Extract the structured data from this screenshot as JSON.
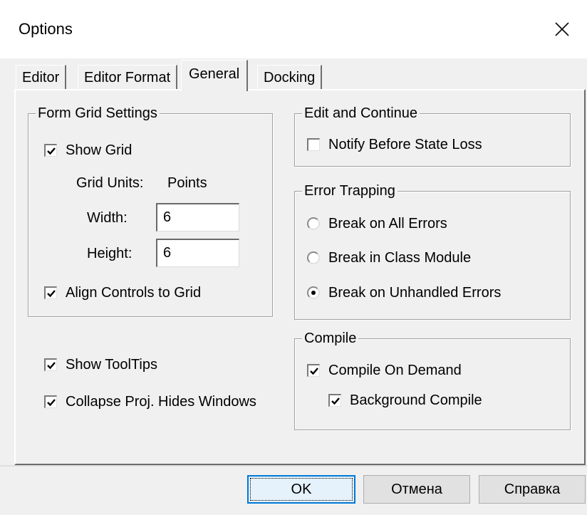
{
  "window": {
    "title": "Options"
  },
  "tabs": [
    {
      "label": "Editor"
    },
    {
      "label": "Editor Format"
    },
    {
      "label": "General",
      "active": true
    },
    {
      "label": "Docking"
    }
  ],
  "form_grid": {
    "title": "Form Grid Settings",
    "show_grid": {
      "label": "Show Grid",
      "checked": true
    },
    "units_label": "Grid Units:",
    "units_value": "Points",
    "width_label": "Width:",
    "width_value": "6",
    "height_label": "Height:",
    "height_value": "6",
    "align": {
      "label": "Align Controls to Grid",
      "checked": true
    }
  },
  "misc": {
    "show_tooltips": {
      "label": "Show ToolTips",
      "checked": true
    },
    "collapse": {
      "label": "Collapse Proj. Hides Windows",
      "checked": true
    }
  },
  "edit_continue": {
    "title": "Edit and Continue",
    "notify": {
      "label": "Notify Before State Loss",
      "checked": false
    }
  },
  "error_trapping": {
    "title": "Error Trapping",
    "options": [
      {
        "label": "Break on All Errors",
        "selected": false
      },
      {
        "label": "Break in Class Module",
        "selected": false
      },
      {
        "label": "Break on Unhandled Errors",
        "selected": true
      }
    ]
  },
  "compile": {
    "title": "Compile",
    "on_demand": {
      "label": "Compile On Demand",
      "checked": true
    },
    "background": {
      "label": "Background Compile",
      "checked": true
    }
  },
  "buttons": {
    "ok": "OK",
    "cancel": "Отмена",
    "help": "Справка"
  },
  "colors": {
    "accent": "#0078d7",
    "face": "#f0f0f0"
  },
  "icons": {
    "close": "close-icon",
    "check": "check-icon"
  }
}
